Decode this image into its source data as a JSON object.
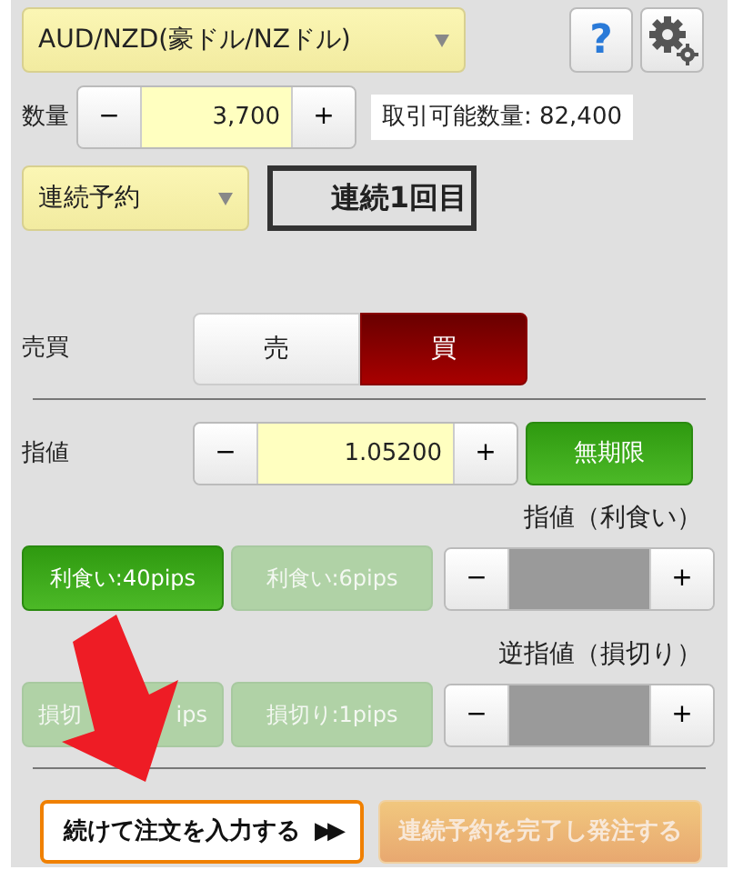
{
  "currency_select": {
    "value": "AUD/NZD(豪ドル/NZドル)"
  },
  "help_button": {
    "label": "?"
  },
  "quantity": {
    "label": "数量",
    "minus": "−",
    "value": "3,700",
    "plus": "+",
    "available": "取引可能数量: 82,400"
  },
  "order_type_select": {
    "value": "連続予約"
  },
  "sequence_label": "連続1回目",
  "side": {
    "label": "売買",
    "options": [
      {
        "label": "売",
        "selected": false
      },
      {
        "label": "買",
        "selected": true
      }
    ]
  },
  "limit_price": {
    "label": "指値",
    "minus": "−",
    "value": "1.05200",
    "plus": "+",
    "expiry_button": "無期限"
  },
  "take_profit": {
    "heading": "指値（利食い）",
    "presets": [
      {
        "label": "利食い:40pips",
        "selected": true
      },
      {
        "label": "利食い:6pips",
        "selected": false
      }
    ],
    "minus": "−",
    "plus": "+",
    "disabled": true
  },
  "stop_loss": {
    "heading": "逆指値（損切り）",
    "presets": [
      {
        "label_start": "損切",
        "label_end": "ips",
        "selected": false
      },
      {
        "label": "損切り:1pips",
        "selected": false
      }
    ],
    "minus": "−",
    "plus": "+",
    "disabled": true
  },
  "actions": [
    {
      "label": "続けて注文を入力する",
      "icon_text": "▶▶",
      "disabled": false
    },
    {
      "label": "連続予約を完了し発注する",
      "disabled": true
    }
  ]
}
